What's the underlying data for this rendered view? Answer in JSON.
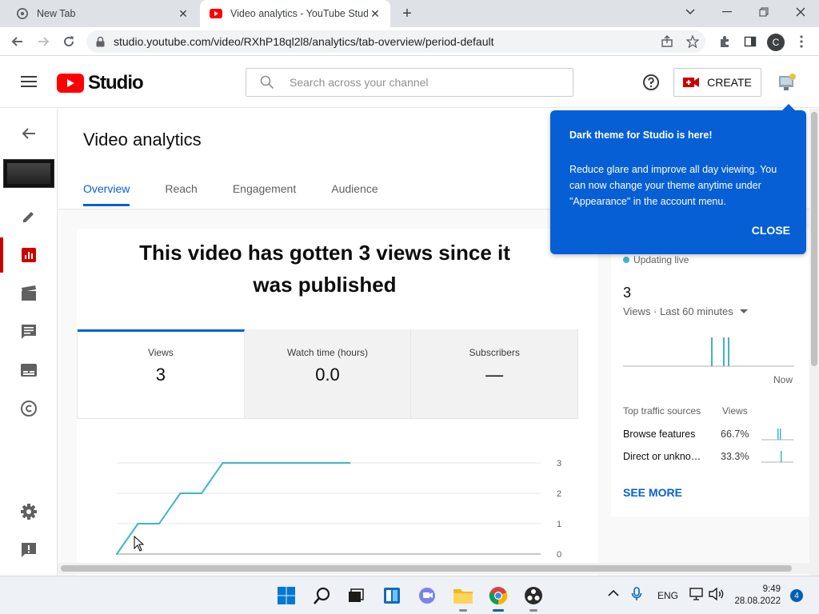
{
  "browser": {
    "tabs": [
      {
        "title": "New Tab",
        "active": false
      },
      {
        "title": "Video analytics - YouTube Studio",
        "active": true
      }
    ],
    "url": "studio.youtube.com/video/RXhP18ql2l8/analytics/tab-overview/period-default",
    "profile_initial": "C"
  },
  "header": {
    "logo_text": "Studio",
    "search_placeholder": "Search across your channel",
    "create_label": "CREATE"
  },
  "page": {
    "title": "Video analytics",
    "tabs": [
      "Overview",
      "Reach",
      "Engagement",
      "Audience"
    ],
    "active_tab": "Overview",
    "headline": "This video has gotten 3 views since it was published"
  },
  "metrics": [
    {
      "label": "Views",
      "value": "3"
    },
    {
      "label": "Watch time (hours)",
      "value": "0.0"
    },
    {
      "label": "Subscribers",
      "value": "—"
    }
  ],
  "chart_data": {
    "type": "line",
    "ylim": [
      0,
      3
    ],
    "yticks": [
      "3",
      "2",
      "1",
      "0"
    ],
    "x": [
      0,
      1,
      2,
      3,
      4,
      5,
      6,
      7,
      8,
      9,
      10,
      11
    ],
    "values": [
      0,
      1,
      1,
      2,
      2,
      3,
      3,
      3,
      3,
      3,
      3,
      3
    ],
    "color": "#41b4c4"
  },
  "realtime": {
    "status": "Updating live",
    "count": "3",
    "period_label": "Views · Last 60 minutes",
    "now_label": "Now",
    "traffic_header": "Top traffic sources",
    "views_header": "Views",
    "sources": [
      {
        "name": "Browse features",
        "pct": "66.7%"
      },
      {
        "name": "Direct or unkno…",
        "pct": "33.3%"
      }
    ],
    "see_more": "SEE MORE"
  },
  "tooltip": {
    "title": "Dark theme for Studio is here!",
    "body": "Reduce glare and improve all day viewing. You can now change your theme anytime under \"Appearance\" in the account menu.",
    "close_label": "CLOSE"
  },
  "taskbar": {
    "language": "ENG",
    "time": "9:49",
    "date": "28.08.2022",
    "notifications": "4"
  },
  "colors": {
    "accent": "#065fd4",
    "brand": "#ff0000",
    "chart": "#41b4c4"
  }
}
